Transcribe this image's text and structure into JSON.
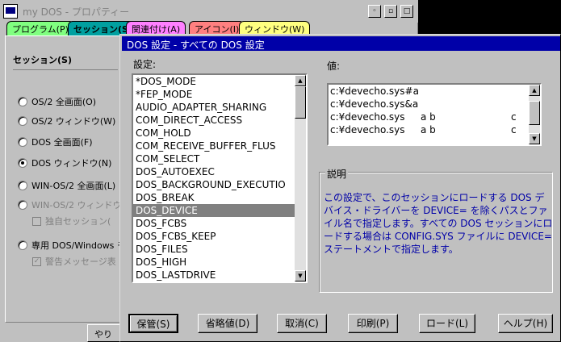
{
  "background_window": {
    "title": "my DOS - プロパティー",
    "tabs": [
      "プログラム(P)",
      "セッション(S)",
      "関連付け(A)",
      "アイコン(I)",
      "ウィンドウ(W)"
    ],
    "group_label": "セッション(S)",
    "radios": [
      {
        "label": "OS/2 全画面(O)",
        "checked": false,
        "enabled": true
      },
      {
        "label": "OS/2 ウィンドウ(W)",
        "checked": false,
        "enabled": true
      },
      {
        "label": "DOS 全画面(F)",
        "checked": false,
        "enabled": true
      },
      {
        "label": "DOS ウィンドウ(N)",
        "checked": true,
        "enabled": true
      },
      {
        "label": "WIN-OS/2 全画面(L)",
        "checked": false,
        "enabled": true
      },
      {
        "label": "WIN-OS/2 ウィンドウ",
        "checked": false,
        "enabled": false
      },
      {
        "label": "専用 DOS/Windows モー",
        "checked": false,
        "enabled": true
      }
    ],
    "checks": [
      {
        "label": "独自セッション(",
        "checked": false
      },
      {
        "label": "警告メッセージ表",
        "checked": true
      }
    ],
    "bottom_button": "やり"
  },
  "dialog": {
    "title": "DOS 設定 - すべての DOS 設定",
    "settings_label": "設定:",
    "value_label": "値:",
    "settings": [
      "*DOS_MODE",
      "*FEP_MODE",
      "AUDIO_ADAPTER_SHARING",
      "COM_DIRECT_ACCESS",
      "COM_HOLD",
      "COM_RECEIVE_BUFFER_FLUS",
      "COM_SELECT",
      "DOS_AUTOEXEC",
      "DOS_BACKGROUND_EXECUTIO",
      "DOS_BREAK",
      "DOS_DEVICE",
      "DOS_FCBS",
      "DOS_FCBS_KEEP",
      "DOS_FILES",
      "DOS_HIGH",
      "DOS_LASTDRIVE"
    ],
    "selected_setting": "DOS_DEVICE",
    "values": [
      [
        "c:¥devecho.sys#a",
        "",
        ""
      ],
      [
        "c:¥devecho.sys&a",
        "",
        ""
      ],
      [
        "c:¥devecho.sys",
        "a b",
        "c"
      ],
      [
        "c:¥devecho.sys",
        "a b",
        "c"
      ]
    ],
    "description_label": "説明",
    "description": "この設定で、このセッションにロードする DOS デバイス・ドライバーを DEVICE= を除くパスとファイル名で指定します。すべての DOS セッションにロードする場合は CONFIG.SYS ファイルに DEVICE= ステートメントで指定します。",
    "buttons": [
      "保管(S)",
      "省略値(D)",
      "取消(C)",
      "印刷(P)",
      "ロード(L)",
      "ヘルプ(H)"
    ]
  }
}
